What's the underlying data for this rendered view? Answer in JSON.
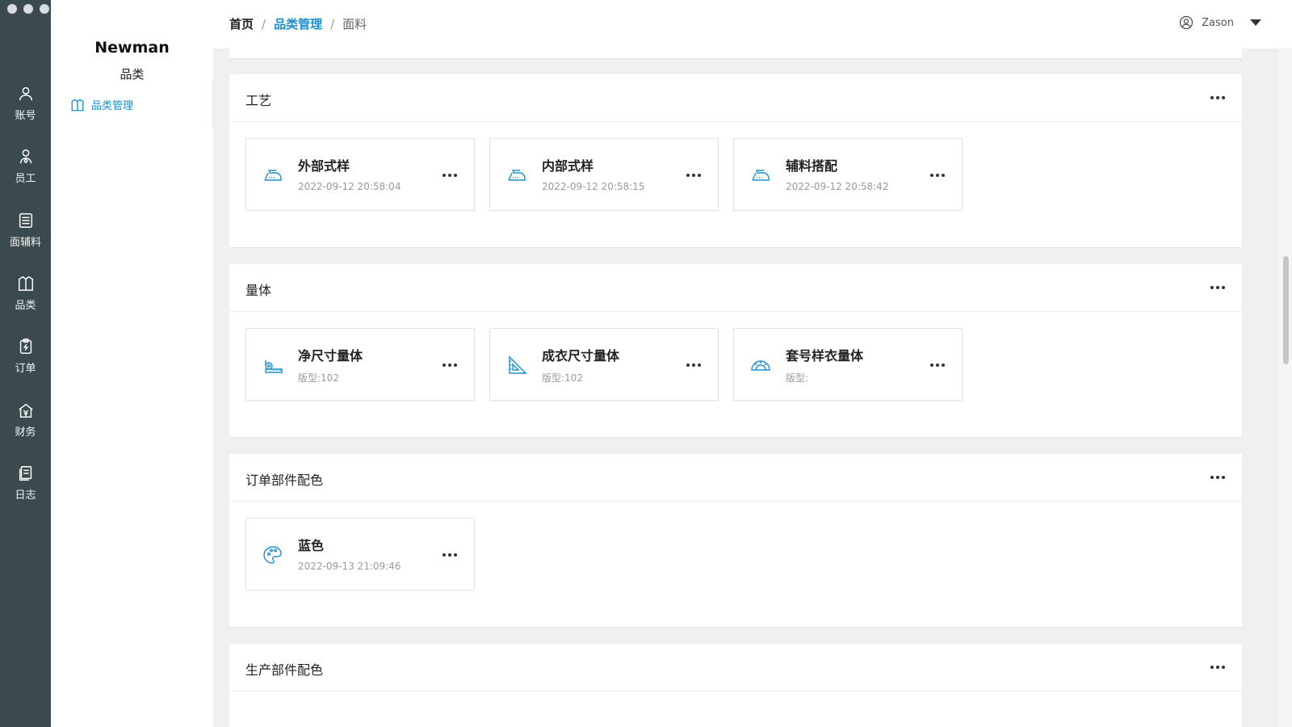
{
  "rail": {
    "items": [
      {
        "label": "账号",
        "icon": "user-icon"
      },
      {
        "label": "员工",
        "icon": "employee-icon"
      },
      {
        "label": "面辅料",
        "icon": "fabric-icon"
      },
      {
        "label": "品类",
        "icon": "shirt-icon"
      },
      {
        "label": "订单",
        "icon": "order-icon"
      },
      {
        "label": "财务",
        "icon": "finance-icon"
      },
      {
        "label": "日志",
        "icon": "log-icon"
      }
    ]
  },
  "sidebar": {
    "brand": "Newman",
    "subtitle": "品类",
    "link": "品类管理"
  },
  "header": {
    "crumb_home": "首页",
    "crumb_mid": "品类管理",
    "crumb_current": "面料",
    "separator": "/",
    "user_name": "Zason"
  },
  "sections": [
    {
      "title": "工艺",
      "cards": [
        {
          "title": "外部式样",
          "sub": "2022-09-12 20:58:04",
          "icon": "iron-icon"
        },
        {
          "title": "内部式样",
          "sub": "2022-09-12 20:58:15",
          "icon": "iron-icon"
        },
        {
          "title": "辅料搭配",
          "sub": "2022-09-12 20:58:42",
          "icon": "iron-icon"
        }
      ]
    },
    {
      "title": "量体",
      "cards": [
        {
          "title": "净尺寸量体",
          "sub": "版型:102",
          "icon": "measure-tape-icon"
        },
        {
          "title": "成衣尺寸量体",
          "sub": "版型:102",
          "icon": "triangle-ruler-icon"
        },
        {
          "title": "套号样衣量体",
          "sub": "版型:",
          "icon": "protractor-icon"
        }
      ]
    },
    {
      "title": "订单部件配色",
      "cards": [
        {
          "title": "蓝色",
          "sub": "2022-09-13 21:09:46",
          "icon": "palette-icon"
        }
      ]
    },
    {
      "title": "生产部件配色",
      "cards": []
    }
  ],
  "colors": {
    "rail_bg": "#3a4a4f",
    "accent": "#1a8fd1"
  }
}
